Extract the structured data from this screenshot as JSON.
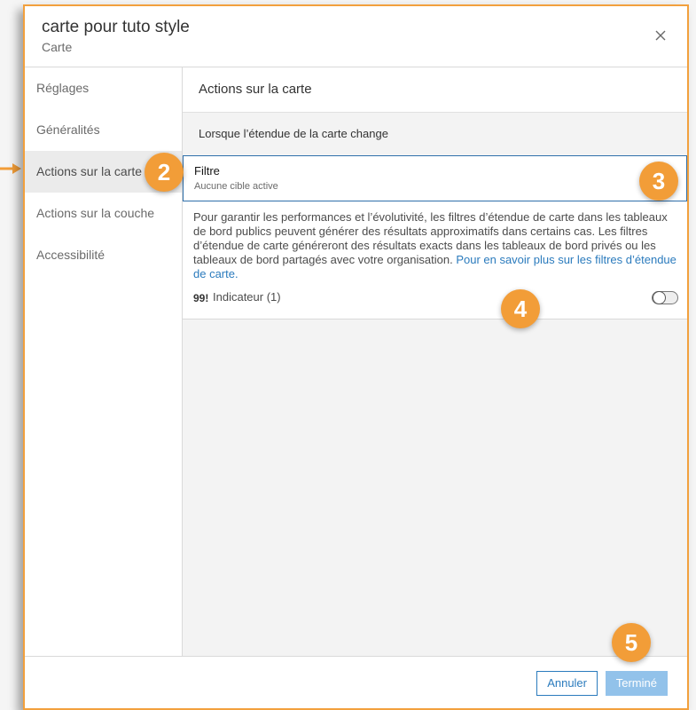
{
  "dialog": {
    "title": "carte pour tuto style",
    "subtitle": "Carte"
  },
  "sidebar": {
    "items": [
      {
        "label": "Réglages"
      },
      {
        "label": "Généralités"
      },
      {
        "label": "Actions sur la carte"
      },
      {
        "label": "Actions sur la couche"
      },
      {
        "label": "Accessibilité"
      }
    ]
  },
  "content": {
    "section_title": "Actions sur la carte",
    "subhead": "Lorsque l’étendue de la carte change",
    "filter": {
      "label": "Filtre",
      "sub": "Aucune cible active"
    },
    "note_text": "Pour garantir les performances et l’évolutivité, les filtres d’étendue de carte dans les tableaux de bord publics peuvent générer des résultats approximatifs dans certains cas. Les filtres d’étendue de carte généreront des résultats exacts dans les tableaux de bord privés ou les tableaux de bord partagés avec votre organisation. ",
    "note_link": "Pour en savoir plus sur les filtres d’étendue de carte.",
    "indicator": {
      "icon_text": "99!",
      "label": "Indicateur (1)",
      "toggle_on": false
    }
  },
  "footer": {
    "cancel_label": "Annuler",
    "done_label": "Terminé"
  },
  "badges": [
    "2",
    "3",
    "4",
    "5"
  ],
  "colors": {
    "accent": "#f29d38",
    "link": "#2b7bbd",
    "focus_border": "#2f6faa",
    "done_disabled": "#92c2ea"
  }
}
